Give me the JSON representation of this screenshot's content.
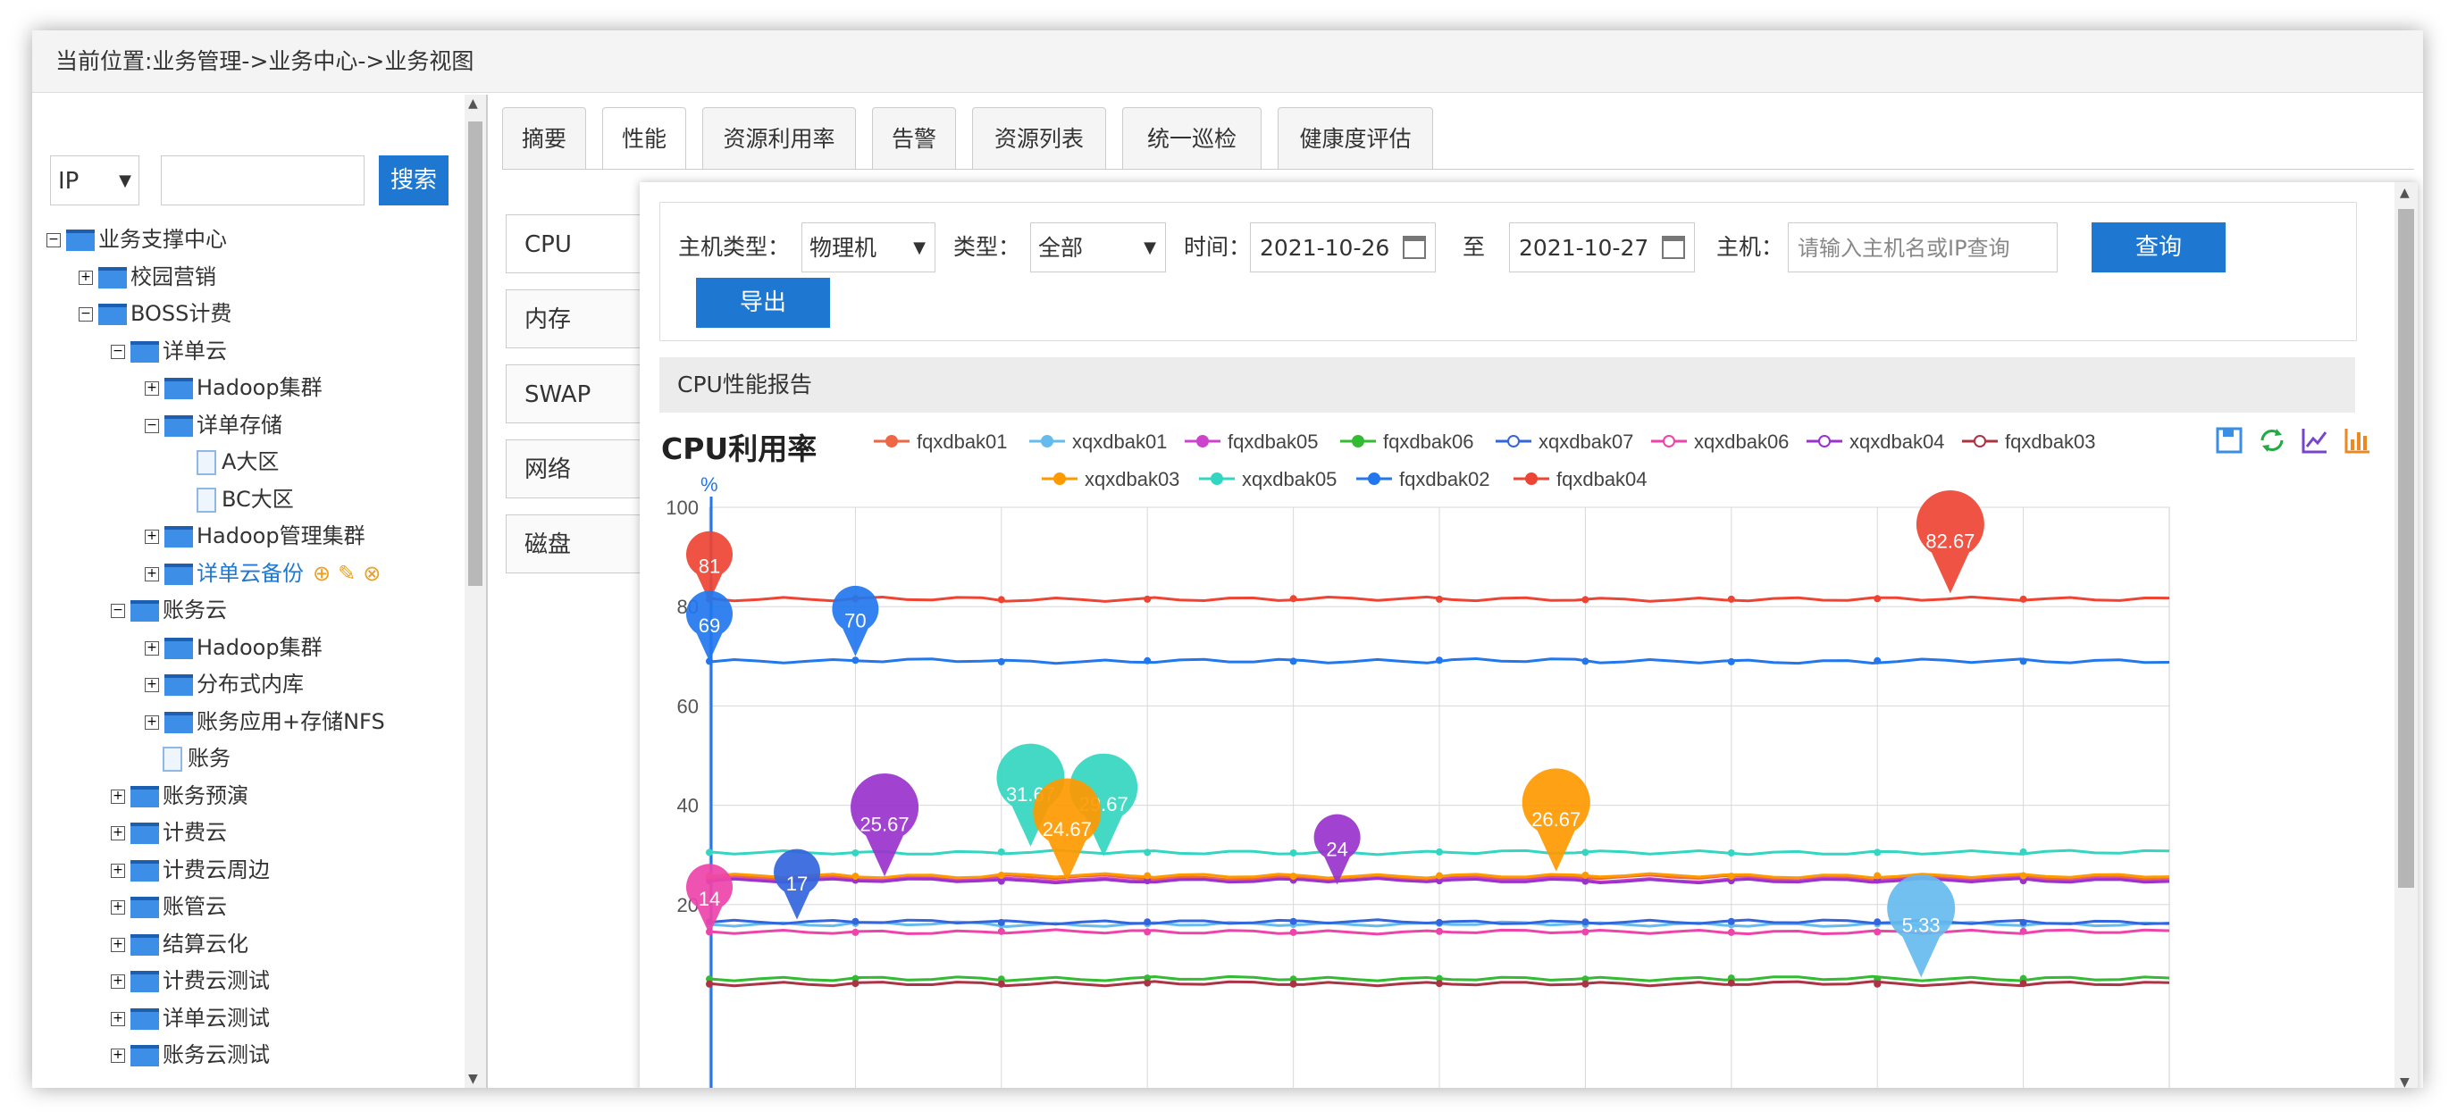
{
  "breadcrumb": "当前位置:业务管理->业务中心->业务视图",
  "sidebar": {
    "search_select": "IP",
    "search_button": "搜索",
    "tree": [
      {
        "label": "业务支撑中心",
        "level": 0,
        "toggle": "⊟",
        "type": "folder"
      },
      {
        "label": "校园营销",
        "level": 1,
        "toggle": "⊞",
        "type": "folder"
      },
      {
        "label": "BOSS计费",
        "level": 1,
        "toggle": "⊟",
        "type": "folder"
      },
      {
        "label": "详单云",
        "level": 2,
        "toggle": "⊟",
        "type": "folder"
      },
      {
        "label": "Hadoop集群",
        "level": 3,
        "toggle": "⊞",
        "type": "folder"
      },
      {
        "label": "详单存储",
        "level": 3,
        "toggle": "⊟",
        "type": "folder"
      },
      {
        "label": "A大区",
        "level": 4,
        "toggle": "",
        "type": "doc"
      },
      {
        "label": "BC大区",
        "level": 4,
        "toggle": "",
        "type": "doc"
      },
      {
        "label": "Hadoop管理集群",
        "level": 3,
        "toggle": "⊞",
        "type": "folder"
      },
      {
        "label": "详单云备份",
        "level": 3,
        "toggle": "⊞",
        "type": "folder",
        "highlight": true
      },
      {
        "label": "账务云",
        "level": 2,
        "toggle": "⊟",
        "type": "folder"
      },
      {
        "label": "Hadoop集群",
        "level": 3,
        "toggle": "⊞",
        "type": "folder"
      },
      {
        "label": "分布式内库",
        "level": 3,
        "toggle": "⊞",
        "type": "folder"
      },
      {
        "label": "账务应用+存储NFS",
        "level": 3,
        "toggle": "⊞",
        "type": "folder"
      },
      {
        "label": "账务",
        "level": 3,
        "toggle": "",
        "type": "doc"
      },
      {
        "label": "账务预演",
        "level": 2,
        "toggle": "⊞",
        "type": "folder"
      },
      {
        "label": "计费云",
        "level": 2,
        "toggle": "⊞",
        "type": "folder"
      },
      {
        "label": "计费云周边",
        "level": 2,
        "toggle": "⊞",
        "type": "folder"
      },
      {
        "label": "账管云",
        "level": 2,
        "toggle": "⊞",
        "type": "folder"
      },
      {
        "label": "结算云化",
        "level": 2,
        "toggle": "⊞",
        "type": "folder"
      },
      {
        "label": "计费云测试",
        "level": 2,
        "toggle": "⊞",
        "type": "folder"
      },
      {
        "label": "详单云测试",
        "level": 2,
        "toggle": "⊞",
        "type": "folder"
      },
      {
        "label": "账务云测试",
        "level": 2,
        "toggle": "⊞",
        "type": "folder"
      }
    ]
  },
  "tabs": [
    "摘要",
    "性能",
    "资源利用率",
    "告警",
    "资源列表",
    "统一巡检",
    "健康度评估"
  ],
  "active_tab": "性能",
  "side_tabs": [
    "CPU",
    "内存",
    "SWAP",
    "网络",
    "磁盘"
  ],
  "filters": {
    "host_type_label": "主机类型：",
    "host_type_value": "物理机",
    "type_label": "类型：",
    "type_value": "全部",
    "time_label": "时间：",
    "date_from": "2021-10-26",
    "to_label": "至",
    "date_to": "2021-10-27",
    "host_label": "主机：",
    "host_placeholder": "请输入主机名或IP查询",
    "query_button": "查询",
    "export_button": "导出"
  },
  "report_title": "CPU性能报告",
  "chart_data": {
    "type": "line",
    "title": "CPU利用率",
    "ylabel": "%",
    "ylim": [
      0,
      100
    ],
    "yticks": [
      20,
      40,
      60,
      80,
      100
    ],
    "grid": true,
    "legend_position": "top",
    "series": [
      {
        "name": "fqxdbak01",
        "color": "#ee6644",
        "marker": "circle",
        "values": [
          25.5,
          25.4,
          25.6,
          25.3,
          25.5,
          25.4,
          25.6,
          25.5,
          25.4,
          25.5
        ]
      },
      {
        "name": "xqxdbak01",
        "color": "#66bbee",
        "marker": "square",
        "values": [
          16,
          16.2,
          15.9,
          16.1,
          16,
          16.2,
          16,
          15.9,
          16.1,
          16
        ]
      },
      {
        "name": "fqxdbak05",
        "color": "#cc44cc",
        "marker": "triangle",
        "values": [
          25,
          25.1,
          25,
          24.9,
          25,
          25.1,
          24.9,
          25,
          25.1,
          25
        ]
      },
      {
        "name": "fqxdbak06",
        "color": "#33bb33",
        "marker": "diamond",
        "values": [
          5,
          5.1,
          5,
          5.2,
          5,
          5.1,
          5,
          5.2,
          5,
          5.1
        ]
      },
      {
        "name": "xqxdbak07",
        "color": "#3366dd",
        "marker": "circle-open",
        "values": [
          16.5,
          16.6,
          16.4,
          16.5,
          16.6,
          16.4,
          16.5,
          16.6,
          16.5,
          16.4
        ]
      },
      {
        "name": "xqxdbak06",
        "color": "#ee44aa",
        "marker": "square-open",
        "values": [
          14.5,
          14.4,
          14.6,
          14.5,
          14.4,
          14.6,
          14.5,
          14.4,
          14.5,
          14.6
        ]
      },
      {
        "name": "xqxdbak04",
        "color": "#9933cc",
        "marker": "triangle-open",
        "values": [
          24.8,
          24.9,
          24.7,
          24.8,
          24.9,
          24.8,
          24.7,
          24.8,
          24.9,
          24.8
        ]
      },
      {
        "name": "fqxdbak03",
        "color": "#aa3344",
        "marker": "diamond-open",
        "values": [
          4,
          4.1,
          4,
          4.2,
          4,
          4.1,
          4,
          4.2,
          4,
          4.1
        ]
      },
      {
        "name": "xqxdbak03",
        "color": "#ff9900",
        "marker": "circle",
        "values": [
          25.8,
          25.7,
          25.9,
          25.8,
          25.7,
          25.8,
          25.9,
          25.7,
          25.8,
          25.8
        ]
      },
      {
        "name": "xqxdbak05",
        "color": "#33d6c0",
        "marker": "square",
        "values": [
          30.5,
          30.4,
          30.6,
          30.5,
          30.4,
          30.6,
          30.5,
          30.4,
          30.5,
          30.6
        ]
      },
      {
        "name": "fqxdbak02",
        "color": "#2277ee",
        "marker": "triangle",
        "values": [
          69,
          69.2,
          68.9,
          69.1,
          69,
          69.2,
          69,
          68.9,
          69.1,
          69
        ]
      },
      {
        "name": "fqxdbak04",
        "color": "#ee4433",
        "marker": "diamond",
        "values": [
          81.5,
          81.6,
          81.4,
          81.5,
          81.6,
          81.5,
          81.4,
          81.5,
          81.6,
          81.5
        ]
      }
    ],
    "annotations": [
      {
        "label": "81",
        "x": 0,
        "value": 81,
        "color": "#ee4433"
      },
      {
        "label": "69",
        "x": 0,
        "value": 69,
        "color": "#2277ee"
      },
      {
        "label": "70",
        "x": 1,
        "value": 70,
        "color": "#2277ee"
      },
      {
        "label": "82.67",
        "x": 8.5,
        "value": 82.67,
        "color": "#ee4433"
      },
      {
        "label": "25.67",
        "x": 1.2,
        "value": 25.67,
        "color": "#9933cc"
      },
      {
        "label": "31.67",
        "x": 2.2,
        "value": 31.67,
        "color": "#33d6c0"
      },
      {
        "label": "29.67",
        "x": 2.7,
        "value": 29.67,
        "color": "#33d6c0"
      },
      {
        "label": "24.67",
        "x": 2.45,
        "value": 24.67,
        "color": "#ff9900"
      },
      {
        "label": "24",
        "x": 4.3,
        "value": 24,
        "color": "#9933cc"
      },
      {
        "label": "26.67",
        "x": 5.8,
        "value": 26.67,
        "color": "#ff9900"
      },
      {
        "label": "17",
        "x": 0.6,
        "value": 17,
        "color": "#3366dd"
      },
      {
        "label": "14",
        "x": 0,
        "value": 14,
        "color": "#ee44aa"
      },
      {
        "label": "5.33",
        "x": 8.3,
        "value": 5.33,
        "color": "#66bbee"
      }
    ]
  }
}
